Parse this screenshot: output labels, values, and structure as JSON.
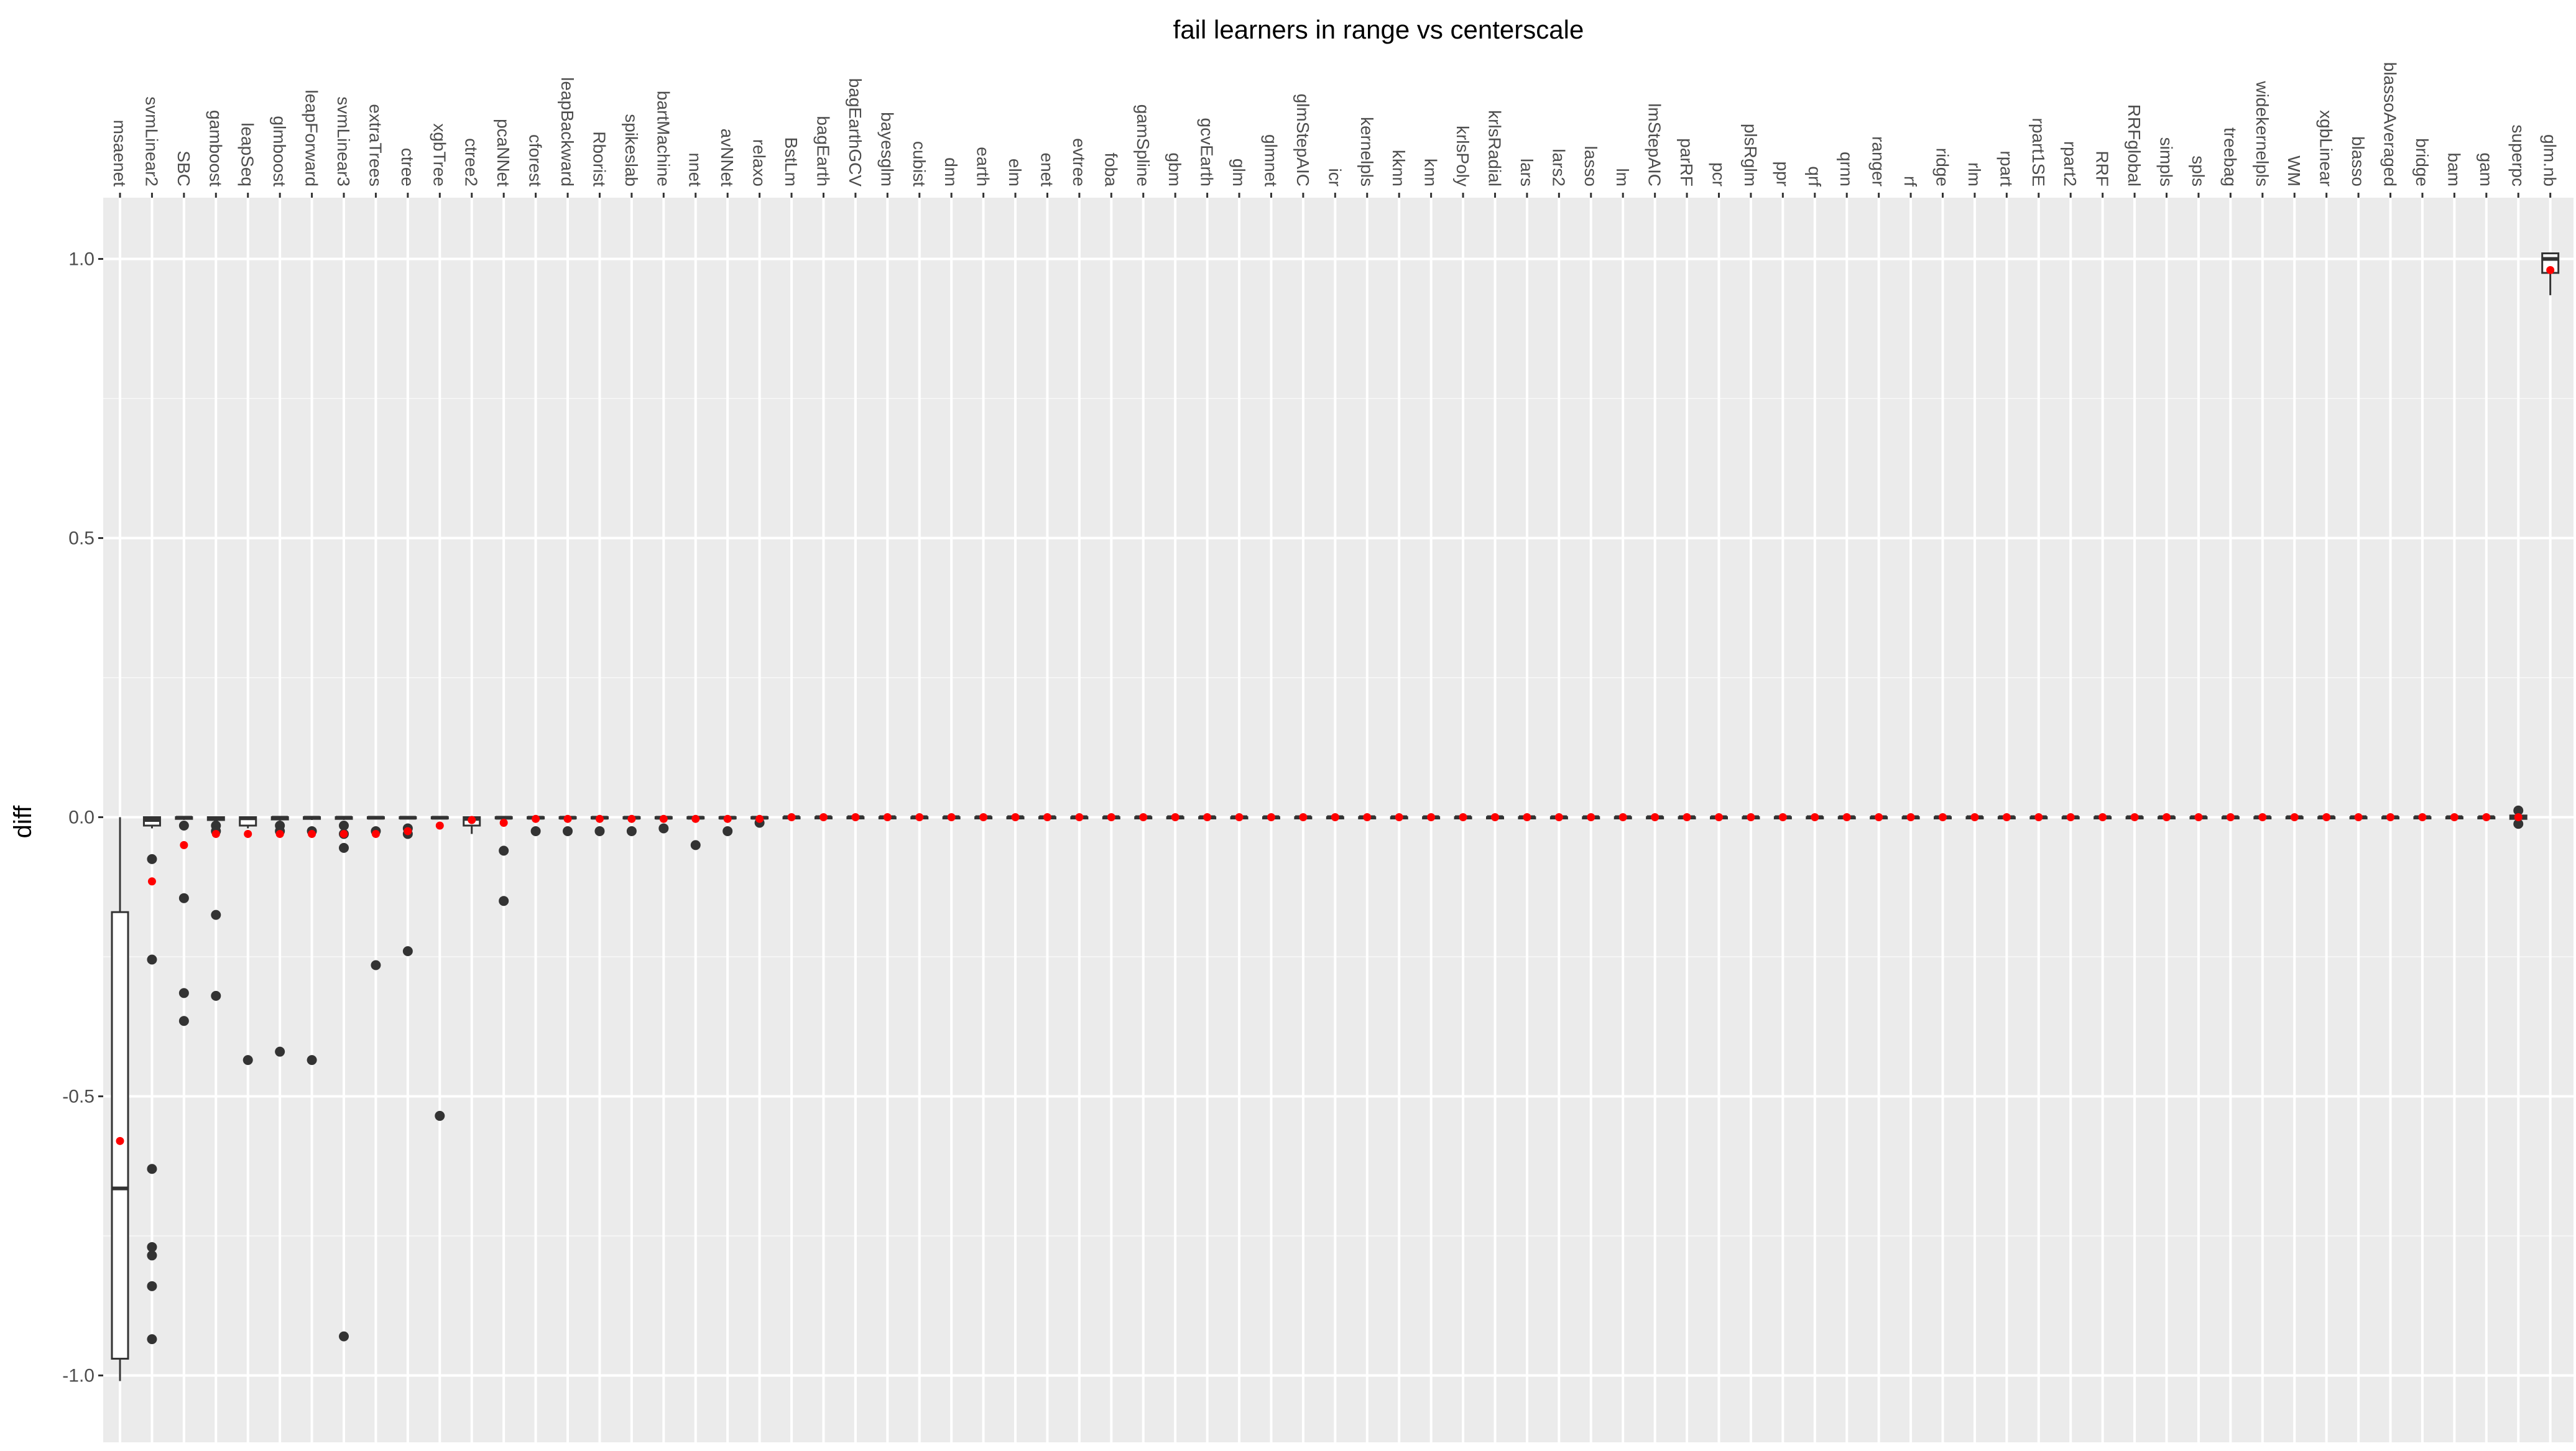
{
  "chart_data": {
    "type": "box",
    "title": "fail learners in range vs centerscale",
    "xlabel": "",
    "ylabel": "diff",
    "ylim": [
      -1.1,
      1.1
    ],
    "y_ticks": [
      -1.0,
      -0.5,
      0.0,
      0.5,
      1.0
    ],
    "y_tick_labels": [
      "-1.0",
      "-0.5",
      "0.0",
      "0.5",
      "1.0"
    ],
    "x_axis_position": "top",
    "x_labels_rotated": true,
    "grid": true,
    "colors": {
      "panel": "#ebebeb",
      "grid_major": "#ffffff",
      "grid_minor": "#f5f5f5",
      "box_outline": "#333333",
      "box_fill": "#ffffff",
      "outlier": "#333333",
      "mean_point": "#ff0000",
      "text": "#4d4d4d"
    },
    "categories": [
      "msaenet",
      "svmLinear2",
      "SBC",
      "gamboost",
      "leapSeq",
      "glmboost",
      "leapForward",
      "svmLinear3",
      "extraTrees",
      "ctree",
      "xgbTree",
      "ctree2",
      "pcaNNet",
      "cforest",
      "leapBackward",
      "Rborist",
      "spikeslab",
      "bartMachine",
      "nnet",
      "avNNet",
      "relaxo",
      "BstLm",
      "bagEarth",
      "bagEarthGCV",
      "bayesglm",
      "cubist",
      "dnn",
      "earth",
      "elm",
      "enet",
      "evtree",
      "foba",
      "gamSpline",
      "gbm",
      "gcvEarth",
      "glm",
      "glmnet",
      "glmStepAIC",
      "icr",
      "kernelpls",
      "kknn",
      "knn",
      "krlsPoly",
      "krlsRadial",
      "lars",
      "lars2",
      "lasso",
      "lm",
      "lmStepAIC",
      "parRF",
      "pcr",
      "plsRglm",
      "ppr",
      "qrf",
      "qrnn",
      "ranger",
      "rf",
      "ridge",
      "rlm",
      "rpart",
      "rpart1SE",
      "rpart2",
      "RRF",
      "RRFglobal",
      "simpls",
      "spls",
      "treebag",
      "widekernelpls",
      "WM",
      "xgbLinear",
      "blasso",
      "blassoAveraged",
      "bridge",
      "bam",
      "gam",
      "superpc",
      "glm.nb"
    ],
    "box_stats": [
      {
        "q1": -0.97,
        "median": -0.665,
        "q3": -0.17,
        "whisker_low": -1.01,
        "whisker_high": 0.0,
        "mean": -0.58,
        "outliers": []
      },
      {
        "q1": -0.015,
        "median": -0.005,
        "q3": 0.0,
        "whisker_low": -0.02,
        "whisker_high": 0.0,
        "mean": -0.115,
        "outliers": [
          -0.075,
          -0.255,
          -0.63,
          -0.77,
          -0.785,
          -0.84,
          -0.935
        ]
      },
      {
        "q1": -0.003,
        "median": -0.001,
        "q3": 0.0,
        "whisker_low": -0.005,
        "whisker_high": 0.0,
        "mean": -0.05,
        "outliers": [
          -0.015,
          -0.145,
          -0.315,
          -0.365
        ]
      },
      {
        "q1": -0.005,
        "median": -0.002,
        "q3": 0.0,
        "whisker_low": -0.008,
        "whisker_high": 0.0,
        "mean": -0.03,
        "outliers": [
          -0.015,
          -0.025,
          -0.175,
          -0.32
        ]
      },
      {
        "q1": -0.015,
        "median": -0.002,
        "q3": 0.0,
        "whisker_low": -0.02,
        "whisker_high": 0.0,
        "mean": -0.03,
        "outliers": [
          -0.435
        ]
      },
      {
        "q1": -0.004,
        "median": -0.001,
        "q3": 0.0,
        "whisker_low": -0.006,
        "whisker_high": 0.0,
        "mean": -0.03,
        "outliers": [
          -0.015,
          -0.025,
          -0.42
        ]
      },
      {
        "q1": -0.003,
        "median": -0.001,
        "q3": 0.0,
        "whisker_low": -0.005,
        "whisker_high": 0.0,
        "mean": -0.03,
        "outliers": [
          -0.025,
          -0.435
        ]
      },
      {
        "q1": -0.003,
        "median": -0.001,
        "q3": 0.0,
        "whisker_low": -0.005,
        "whisker_high": 0.0,
        "mean": -0.03,
        "outliers": [
          -0.015,
          -0.03,
          -0.055,
          -0.93
        ]
      },
      {
        "q1": -0.002,
        "median": -0.001,
        "q3": 0.0,
        "whisker_low": -0.004,
        "whisker_high": 0.0,
        "mean": -0.03,
        "outliers": [
          -0.025,
          -0.265
        ]
      },
      {
        "q1": -0.002,
        "median": -0.001,
        "q3": 0.0,
        "whisker_low": -0.004,
        "whisker_high": 0.0,
        "mean": -0.025,
        "outliers": [
          -0.02,
          -0.03,
          -0.24
        ]
      },
      {
        "q1": -0.002,
        "median": -0.001,
        "q3": 0.0,
        "whisker_low": -0.004,
        "whisker_high": 0.0,
        "mean": -0.015,
        "outliers": [
          -0.535
        ]
      },
      {
        "q1": -0.015,
        "median": -0.003,
        "q3": 0.0,
        "whisker_low": -0.03,
        "whisker_high": 0.0,
        "mean": -0.005,
        "outliers": []
      },
      {
        "q1": -0.002,
        "median": -0.001,
        "q3": 0.0,
        "whisker_low": -0.003,
        "whisker_high": 0.0,
        "mean": -0.01,
        "outliers": [
          -0.06,
          -0.15
        ]
      },
      {
        "q1": -0.002,
        "median": -0.001,
        "q3": 0.0,
        "whisker_low": -0.003,
        "whisker_high": 0.0,
        "mean": -0.003,
        "outliers": [
          -0.025
        ]
      },
      {
        "q1": -0.002,
        "median": -0.001,
        "q3": 0.0,
        "whisker_low": -0.003,
        "whisker_high": 0.0,
        "mean": -0.003,
        "outliers": [
          -0.025
        ]
      },
      {
        "q1": -0.002,
        "median": -0.001,
        "q3": 0.0,
        "whisker_low": -0.003,
        "whisker_high": 0.0,
        "mean": -0.003,
        "outliers": [
          -0.025
        ]
      },
      {
        "q1": -0.002,
        "median": -0.001,
        "q3": 0.0,
        "whisker_low": -0.003,
        "whisker_high": 0.0,
        "mean": -0.003,
        "outliers": [
          -0.025
        ]
      },
      {
        "q1": -0.002,
        "median": -0.001,
        "q3": 0.0,
        "whisker_low": -0.003,
        "whisker_high": 0.0,
        "mean": -0.003,
        "outliers": [
          -0.02
        ]
      },
      {
        "q1": -0.002,
        "median": -0.001,
        "q3": 0.0,
        "whisker_low": -0.003,
        "whisker_high": 0.0,
        "mean": -0.003,
        "outliers": [
          -0.05
        ]
      },
      {
        "q1": -0.002,
        "median": -0.001,
        "q3": 0.0,
        "whisker_low": -0.003,
        "whisker_high": 0.0,
        "mean": -0.003,
        "outliers": [
          -0.025
        ]
      },
      {
        "q1": -0.002,
        "median": -0.001,
        "q3": 0.0,
        "whisker_low": -0.003,
        "whisker_high": 0.0,
        "mean": -0.003,
        "outliers": [
          -0.01
        ]
      },
      {
        "q1": 0.0,
        "median": 0.0,
        "q3": 0.0,
        "whisker_low": 0.0,
        "whisker_high": 0.0,
        "mean": 0.0,
        "outliers": []
      },
      {
        "q1": 0.0,
        "median": 0.0,
        "q3": 0.0,
        "whisker_low": 0.0,
        "whisker_high": 0.0,
        "mean": 0.0,
        "outliers": []
      },
      {
        "q1": 0.0,
        "median": 0.0,
        "q3": 0.0,
        "whisker_low": 0.0,
        "whisker_high": 0.0,
        "mean": 0.0,
        "outliers": []
      },
      {
        "q1": 0.0,
        "median": 0.0,
        "q3": 0.0,
        "whisker_low": 0.0,
        "whisker_high": 0.0,
        "mean": 0.0,
        "outliers": []
      },
      {
        "q1": 0.0,
        "median": 0.0,
        "q3": 0.0,
        "whisker_low": 0.0,
        "whisker_high": 0.0,
        "mean": 0.0,
        "outliers": []
      },
      {
        "q1": 0.0,
        "median": 0.0,
        "q3": 0.0,
        "whisker_low": 0.0,
        "whisker_high": 0.0,
        "mean": 0.0,
        "outliers": []
      },
      {
        "q1": 0.0,
        "median": 0.0,
        "q3": 0.0,
        "whisker_low": 0.0,
        "whisker_high": 0.0,
        "mean": 0.0,
        "outliers": []
      },
      {
        "q1": 0.0,
        "median": 0.0,
        "q3": 0.0,
        "whisker_low": 0.0,
        "whisker_high": 0.0,
        "mean": 0.0,
        "outliers": []
      },
      {
        "q1": 0.0,
        "median": 0.0,
        "q3": 0.0,
        "whisker_low": 0.0,
        "whisker_high": 0.0,
        "mean": 0.0,
        "outliers": []
      },
      {
        "q1": 0.0,
        "median": 0.0,
        "q3": 0.0,
        "whisker_low": 0.0,
        "whisker_high": 0.0,
        "mean": 0.0,
        "outliers": []
      },
      {
        "q1": 0.0,
        "median": 0.0,
        "q3": 0.0,
        "whisker_low": 0.0,
        "whisker_high": 0.0,
        "mean": 0.0,
        "outliers": []
      },
      {
        "q1": 0.0,
        "median": 0.0,
        "q3": 0.0,
        "whisker_low": 0.0,
        "whisker_high": 0.0,
        "mean": 0.0,
        "outliers": []
      },
      {
        "q1": 0.0,
        "median": 0.0,
        "q3": 0.0,
        "whisker_low": 0.0,
        "whisker_high": 0.0,
        "mean": 0.0,
        "outliers": []
      },
      {
        "q1": 0.0,
        "median": 0.0,
        "q3": 0.0,
        "whisker_low": 0.0,
        "whisker_high": 0.0,
        "mean": 0.0,
        "outliers": []
      },
      {
        "q1": 0.0,
        "median": 0.0,
        "q3": 0.0,
        "whisker_low": 0.0,
        "whisker_high": 0.0,
        "mean": 0.0,
        "outliers": []
      },
      {
        "q1": 0.0,
        "median": 0.0,
        "q3": 0.0,
        "whisker_low": 0.0,
        "whisker_high": 0.0,
        "mean": 0.0,
        "outliers": []
      },
      {
        "q1": 0.0,
        "median": 0.0,
        "q3": 0.0,
        "whisker_low": 0.0,
        "whisker_high": 0.0,
        "mean": 0.0,
        "outliers": []
      },
      {
        "q1": 0.0,
        "median": 0.0,
        "q3": 0.0,
        "whisker_low": 0.0,
        "whisker_high": 0.0,
        "mean": 0.0,
        "outliers": []
      },
      {
        "q1": 0.0,
        "median": 0.0,
        "q3": 0.0,
        "whisker_low": 0.0,
        "whisker_high": 0.0,
        "mean": 0.0,
        "outliers": []
      },
      {
        "q1": 0.0,
        "median": 0.0,
        "q3": 0.0,
        "whisker_low": 0.0,
        "whisker_high": 0.0,
        "mean": 0.0,
        "outliers": []
      },
      {
        "q1": 0.0,
        "median": 0.0,
        "q3": 0.0,
        "whisker_low": 0.0,
        "whisker_high": 0.0,
        "mean": 0.0,
        "outliers": []
      },
      {
        "q1": 0.0,
        "median": 0.0,
        "q3": 0.0,
        "whisker_low": 0.0,
        "whisker_high": 0.0,
        "mean": 0.0,
        "outliers": []
      },
      {
        "q1": 0.0,
        "median": 0.0,
        "q3": 0.0,
        "whisker_low": 0.0,
        "whisker_high": 0.0,
        "mean": 0.0,
        "outliers": []
      },
      {
        "q1": 0.0,
        "median": 0.0,
        "q3": 0.0,
        "whisker_low": 0.0,
        "whisker_high": 0.0,
        "mean": 0.0,
        "outliers": []
      },
      {
        "q1": 0.0,
        "median": 0.0,
        "q3": 0.0,
        "whisker_low": 0.0,
        "whisker_high": 0.0,
        "mean": 0.0,
        "outliers": []
      },
      {
        "q1": 0.0,
        "median": 0.0,
        "q3": 0.0,
        "whisker_low": 0.0,
        "whisker_high": 0.0,
        "mean": 0.0,
        "outliers": []
      },
      {
        "q1": 0.0,
        "median": 0.0,
        "q3": 0.0,
        "whisker_low": 0.0,
        "whisker_high": 0.0,
        "mean": 0.0,
        "outliers": []
      },
      {
        "q1": 0.0,
        "median": 0.0,
        "q3": 0.0,
        "whisker_low": 0.0,
        "whisker_high": 0.0,
        "mean": 0.0,
        "outliers": []
      },
      {
        "q1": 0.0,
        "median": 0.0,
        "q3": 0.0,
        "whisker_low": 0.0,
        "whisker_high": 0.0,
        "mean": 0.0,
        "outliers": []
      },
      {
        "q1": 0.0,
        "median": 0.0,
        "q3": 0.0,
        "whisker_low": 0.0,
        "whisker_high": 0.0,
        "mean": 0.0,
        "outliers": []
      },
      {
        "q1": 0.0,
        "median": 0.0,
        "q3": 0.0,
        "whisker_low": 0.0,
        "whisker_high": 0.0,
        "mean": 0.0,
        "outliers": []
      },
      {
        "q1": 0.0,
        "median": 0.0,
        "q3": 0.0,
        "whisker_low": 0.0,
        "whisker_high": 0.0,
        "mean": 0.0,
        "outliers": []
      },
      {
        "q1": 0.0,
        "median": 0.0,
        "q3": 0.0,
        "whisker_low": 0.0,
        "whisker_high": 0.0,
        "mean": 0.0,
        "outliers": []
      },
      {
        "q1": 0.0,
        "median": 0.0,
        "q3": 0.0,
        "whisker_low": 0.0,
        "whisker_high": 0.0,
        "mean": 0.0,
        "outliers": []
      },
      {
        "q1": 0.0,
        "median": 0.0,
        "q3": 0.0,
        "whisker_low": 0.0,
        "whisker_high": 0.0,
        "mean": 0.0,
        "outliers": []
      },
      {
        "q1": 0.0,
        "median": 0.0,
        "q3": 0.0,
        "whisker_low": 0.0,
        "whisker_high": 0.0,
        "mean": 0.0,
        "outliers": []
      },
      {
        "q1": 0.0,
        "median": 0.0,
        "q3": 0.0,
        "whisker_low": 0.0,
        "whisker_high": 0.0,
        "mean": 0.0,
        "outliers": []
      },
      {
        "q1": 0.0,
        "median": 0.0,
        "q3": 0.0,
        "whisker_low": 0.0,
        "whisker_high": 0.0,
        "mean": 0.0,
        "outliers": []
      },
      {
        "q1": 0.0,
        "median": 0.0,
        "q3": 0.0,
        "whisker_low": 0.0,
        "whisker_high": 0.0,
        "mean": 0.0,
        "outliers": []
      },
      {
        "q1": 0.0,
        "median": 0.0,
        "q3": 0.0,
        "whisker_low": 0.0,
        "whisker_high": 0.0,
        "mean": 0.0,
        "outliers": []
      },
      {
        "q1": 0.0,
        "median": 0.0,
        "q3": 0.0,
        "whisker_low": 0.0,
        "whisker_high": 0.0,
        "mean": 0.0,
        "outliers": []
      },
      {
        "q1": 0.0,
        "median": 0.0,
        "q3": 0.0,
        "whisker_low": 0.0,
        "whisker_high": 0.0,
        "mean": 0.0,
        "outliers": []
      },
      {
        "q1": 0.0,
        "median": 0.0,
        "q3": 0.0,
        "whisker_low": 0.0,
        "whisker_high": 0.0,
        "mean": 0.0,
        "outliers": []
      },
      {
        "q1": 0.0,
        "median": 0.0,
        "q3": 0.0,
        "whisker_low": 0.0,
        "whisker_high": 0.0,
        "mean": 0.0,
        "outliers": []
      },
      {
        "q1": 0.0,
        "median": 0.0,
        "q3": 0.0,
        "whisker_low": 0.0,
        "whisker_high": 0.0,
        "mean": 0.0,
        "outliers": []
      },
      {
        "q1": 0.0,
        "median": 0.0,
        "q3": 0.0,
        "whisker_low": 0.0,
        "whisker_high": 0.0,
        "mean": 0.0,
        "outliers": []
      },
      {
        "q1": 0.0,
        "median": 0.0,
        "q3": 0.0,
        "whisker_low": 0.0,
        "whisker_high": 0.0,
        "mean": 0.0,
        "outliers": []
      },
      {
        "q1": 0.0,
        "median": 0.0,
        "q3": 0.0,
        "whisker_low": 0.0,
        "whisker_high": 0.0,
        "mean": 0.0,
        "outliers": []
      },
      {
        "q1": 0.0,
        "median": 0.0,
        "q3": 0.0,
        "whisker_low": 0.0,
        "whisker_high": 0.0,
        "mean": 0.0,
        "outliers": []
      },
      {
        "q1": 0.0,
        "median": 0.0,
        "q3": 0.0,
        "whisker_low": 0.0,
        "whisker_high": 0.0,
        "mean": 0.0,
        "outliers": []
      },
      {
        "q1": 0.0,
        "median": 0.0,
        "q3": 0.0,
        "whisker_low": 0.0,
        "whisker_high": 0.0,
        "mean": 0.0,
        "outliers": []
      },
      {
        "q1": 0.0,
        "median": 0.0,
        "q3": 0.0,
        "whisker_low": 0.0,
        "whisker_high": 0.0,
        "mean": 0.0,
        "outliers": []
      },
      {
        "q1": 0.0,
        "median": 0.0,
        "q3": 0.0,
        "whisker_low": 0.0,
        "whisker_high": 0.0,
        "mean": 0.0,
        "outliers": []
      },
      {
        "q1": 0.0,
        "median": 0.0,
        "q3": 0.0,
        "whisker_low": 0.0,
        "whisker_high": 0.0,
        "mean": 0.0,
        "outliers": []
      },
      {
        "q1": -0.003,
        "median": 0.0,
        "q3": 0.003,
        "whisker_low": -0.006,
        "whisker_high": 0.006,
        "mean": 0.0,
        "outliers": [
          0.012,
          -0.012
        ]
      },
      {
        "q1": 0.975,
        "median": 1.0,
        "q3": 1.01,
        "whisker_low": 0.935,
        "whisker_high": 1.01,
        "mean": 0.98,
        "outliers": []
      }
    ]
  }
}
